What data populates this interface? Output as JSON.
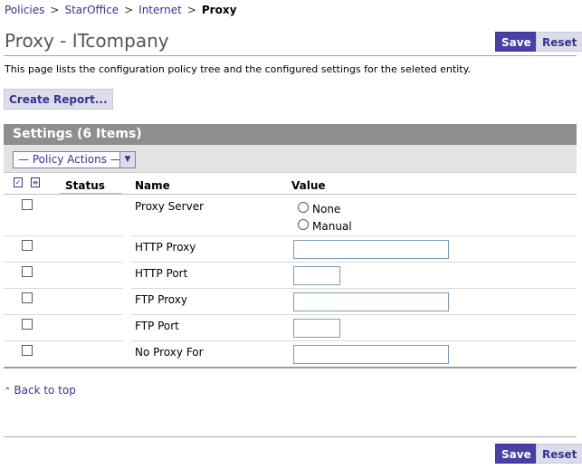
{
  "breadcrumb": {
    "items": [
      "Policies",
      "StarOffice",
      "Internet"
    ],
    "separator": ">",
    "current": "Proxy"
  },
  "page": {
    "title": "Proxy - ITcompany",
    "description": "This page lists the configuration policy tree and the configured settings for the seleted entity."
  },
  "buttons": {
    "save": "Save",
    "reset": "Reset",
    "create_report": "Create Report..."
  },
  "table": {
    "title": "Settings (6 Items)",
    "policy_actions": "— Policy Actions —",
    "columns": {
      "status": "Status",
      "name": "Name",
      "value": "Value"
    },
    "rows": [
      {
        "name": "Proxy Server",
        "options": [
          "None",
          "Manual"
        ]
      },
      {
        "name": "HTTP Proxy"
      },
      {
        "name": "HTTP Port"
      },
      {
        "name": "FTP Proxy"
      },
      {
        "name": "FTP Port"
      },
      {
        "name": "No Proxy For"
      }
    ]
  },
  "footer": {
    "back_to_top": "Back to top"
  },
  "colors": {
    "accent": "#4a3fa4",
    "link": "#35358f",
    "header_bar": "#8e8e8e",
    "secondary_button": "#dcdcea"
  },
  "icons": {
    "select_all": "checkbox-select-all-icon",
    "deselect_all": "checkbox-deselect-all-icon",
    "back_to_top": "double-chevron-up-icon",
    "dropdown": "chevron-down-icon"
  }
}
